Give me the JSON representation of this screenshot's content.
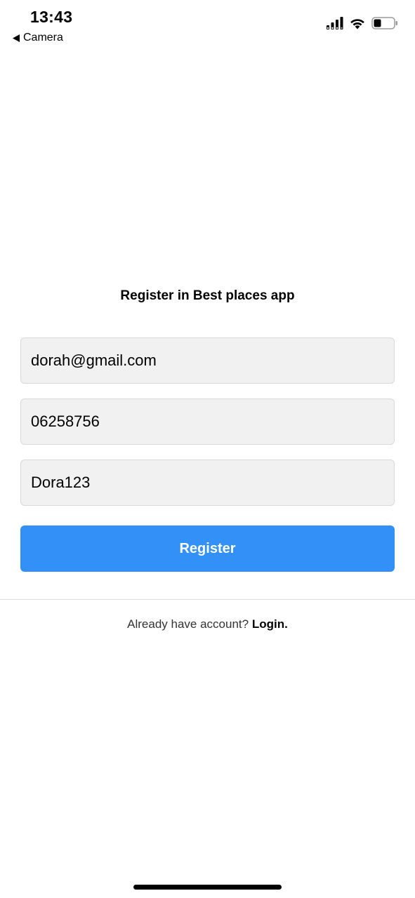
{
  "status_bar": {
    "time": "13:43",
    "back_label": "Camera",
    "icons": [
      "back-arrow-icon",
      "cellular-signal-icon",
      "wifi-icon",
      "battery-icon"
    ]
  },
  "register": {
    "title": "Register in Best places app",
    "email_value": "dorah@gmail.com",
    "phone_value": "06258756",
    "password_value": "Dora123",
    "button_label": "Register"
  },
  "footer": {
    "prompt": "Already have account?",
    "login_label": "Login."
  },
  "colors": {
    "accent": "#3390f6",
    "field_background": "#f1f1f1",
    "field_border": "#d9d9d9",
    "divider": "#dadada"
  }
}
